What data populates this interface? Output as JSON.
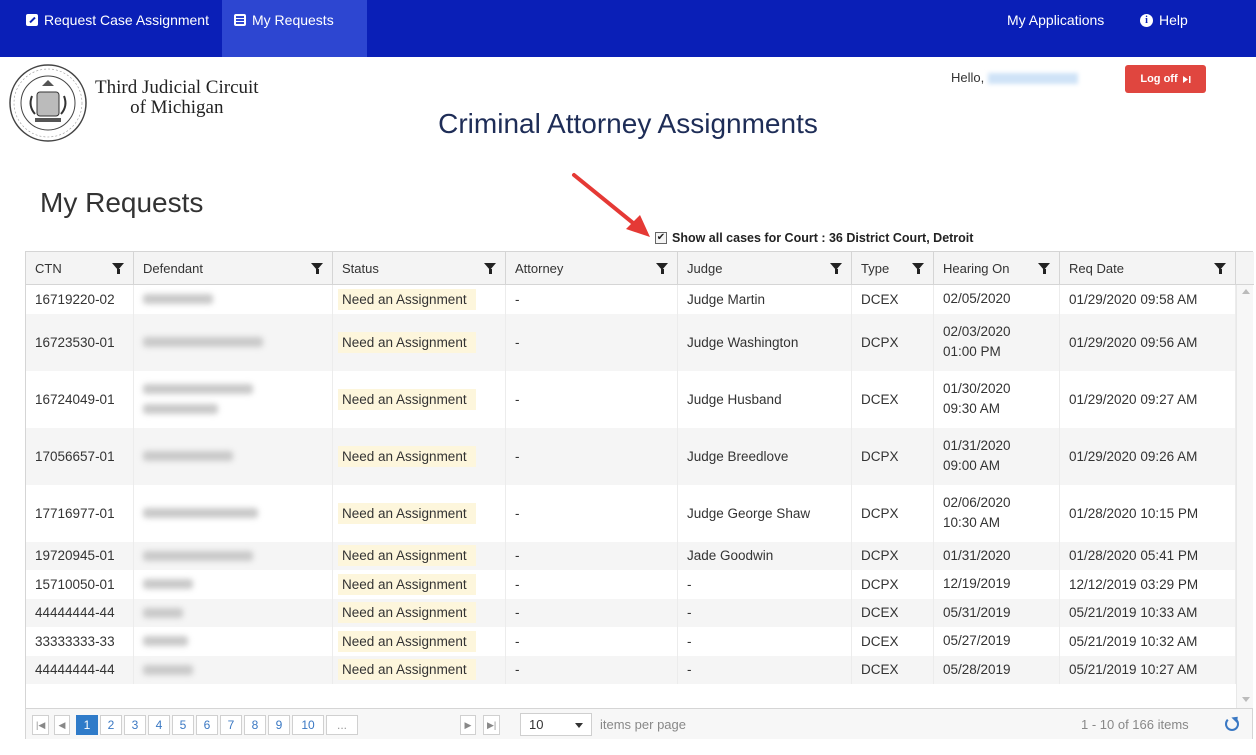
{
  "nav": {
    "left_items": [
      {
        "label": "Request Case Assignment",
        "icon": "edit-icon"
      },
      {
        "label": "My Requests",
        "icon": "list-icon",
        "active": true
      }
    ],
    "right_items": [
      {
        "label": "My Applications"
      },
      {
        "label": "Help",
        "icon": "info-icon"
      }
    ]
  },
  "header": {
    "court_line1": "Third Judicial Circuit",
    "court_line2": "of Michigan",
    "hello": "Hello,",
    "logoff": "Log off",
    "app_title": "Criminal Attorney Assignments"
  },
  "page": {
    "title": "My Requests",
    "show_all_label": "Show all cases for Court : 36 District Court, Detroit",
    "show_all_checked": true
  },
  "grid": {
    "columns": [
      "CTN",
      "Defendant",
      "Status",
      "Attorney",
      "Judge",
      "Type",
      "Hearing On",
      "Req Date"
    ],
    "rows": [
      {
        "ctn": "16719220-02",
        "status": "Need an Assignment",
        "attorney": "-",
        "judge": "Judge Martin",
        "type": "DCEX",
        "hearing": "02/05/2020",
        "req": "01/29/2020 09:58 AM"
      },
      {
        "ctn": "16723530-01",
        "status": "Need an Assignment",
        "attorney": "-",
        "judge": "Judge Washington",
        "type": "DCPX",
        "hearing": "02/03/2020 01:00 PM",
        "req": "01/29/2020 09:56 AM"
      },
      {
        "ctn": "16724049-01",
        "status": "Need an Assignment",
        "attorney": "-",
        "judge": "Judge Husband",
        "type": "DCEX",
        "hearing": "01/30/2020 09:30 AM",
        "req": "01/29/2020 09:27 AM"
      },
      {
        "ctn": "17056657-01",
        "status": "Need an Assignment",
        "attorney": "-",
        "judge": "Judge Breedlove",
        "type": "DCPX",
        "hearing": "01/31/2020 09:00 AM",
        "req": "01/29/2020 09:26 AM"
      },
      {
        "ctn": "17716977-01",
        "status": "Need an Assignment",
        "attorney": "-",
        "judge": "Judge George Shaw",
        "type": "DCPX",
        "hearing": "02/06/2020 10:30 AM",
        "req": "01/28/2020 10:15 PM"
      },
      {
        "ctn": "19720945-01",
        "status": "Need an Assignment",
        "attorney": "-",
        "judge": "Jade Goodwin",
        "type": "DCPX",
        "hearing": "01/31/2020",
        "req": "01/28/2020 05:41 PM"
      },
      {
        "ctn": "15710050-01",
        "status": "Need an Assignment",
        "attorney": "-",
        "judge": "-",
        "type": "DCPX",
        "hearing": "12/19/2019",
        "req": "12/12/2019 03:29 PM"
      },
      {
        "ctn": "44444444-44",
        "status": "Need an Assignment",
        "attorney": "-",
        "judge": "-",
        "type": "DCEX",
        "hearing": "05/31/2019",
        "req": "05/21/2019 10:33 AM"
      },
      {
        "ctn": "33333333-33",
        "status": "Need an Assignment",
        "attorney": "-",
        "judge": "-",
        "type": "DCEX",
        "hearing": "05/27/2019",
        "req": "05/21/2019 10:32 AM"
      },
      {
        "ctn": "44444444-44",
        "status": "Need an Assignment",
        "attorney": "-",
        "judge": "-",
        "type": "DCEX",
        "hearing": "05/28/2019",
        "req": "05/21/2019 10:27 AM"
      }
    ]
  },
  "pager": {
    "pages": [
      "1",
      "2",
      "3",
      "4",
      "5",
      "6",
      "7",
      "8",
      "9",
      "10",
      "..."
    ],
    "current": "1",
    "per_page": "10",
    "per_page_label": "items per page",
    "items_count": "1 - 10 of 166 items"
  },
  "colors": {
    "navbar": "#0a1fb7",
    "navbar_active": "#2d46d1",
    "logoff": "#e0463f",
    "status_highlight": "#fdf6dc",
    "pager_active": "#2f7bc9",
    "arrow": "#e53935"
  }
}
